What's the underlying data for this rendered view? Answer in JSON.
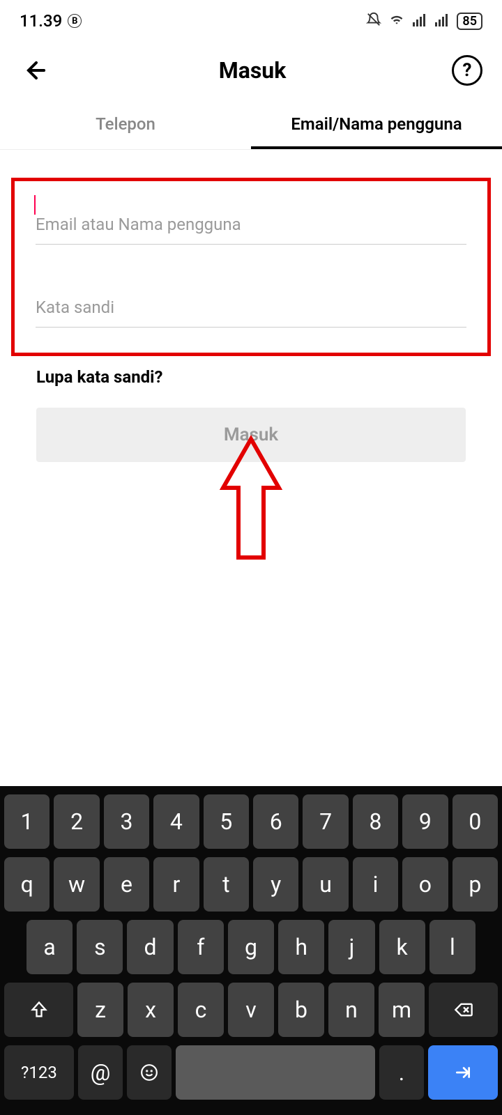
{
  "status": {
    "time": "11.39",
    "battery": "85"
  },
  "header": {
    "title": "Masuk"
  },
  "tabs": {
    "phone": "Telepon",
    "email": "Email/Nama pengguna"
  },
  "form": {
    "username_placeholder": "Email atau Nama pengguna",
    "password_placeholder": "Kata sandi",
    "username_value": "",
    "password_value": ""
  },
  "links": {
    "forgot": "Lupa kata sandi?"
  },
  "buttons": {
    "login": "Masuk"
  },
  "keyboard": {
    "row1": [
      "1",
      "2",
      "3",
      "4",
      "5",
      "6",
      "7",
      "8",
      "9",
      "0"
    ],
    "row2": [
      "q",
      "w",
      "e",
      "r",
      "t",
      "y",
      "u",
      "i",
      "o",
      "p"
    ],
    "row3": [
      "a",
      "s",
      "d",
      "f",
      "g",
      "h",
      "j",
      "k",
      "l"
    ],
    "row4": [
      "z",
      "x",
      "c",
      "v",
      "b",
      "n",
      "m"
    ],
    "symbols": "?123",
    "at": "@",
    "period": "."
  }
}
